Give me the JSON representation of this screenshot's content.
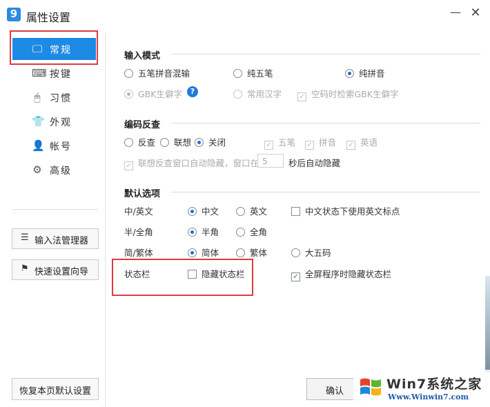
{
  "window": {
    "title": "属性设置",
    "app_icon": "9",
    "minimize": "—",
    "close": "✕"
  },
  "sidebar": {
    "items": [
      {
        "label": "常规",
        "icon": "monitor-icon",
        "glyph": "🖵",
        "active": true
      },
      {
        "label": "按键",
        "icon": "keyboard-icon",
        "glyph": "⌨"
      },
      {
        "label": "习惯",
        "icon": "mouse-icon",
        "glyph": "🖱"
      },
      {
        "label": "外观",
        "icon": "shirt-icon",
        "glyph": "👕"
      },
      {
        "label": "帐号",
        "icon": "user-icon",
        "glyph": "👤"
      },
      {
        "label": "高级",
        "icon": "gear-icon",
        "glyph": "⚙"
      }
    ],
    "buttons": [
      {
        "label": "输入法管理器",
        "icon": "list-icon",
        "glyph": "☰"
      },
      {
        "label": "快速设置向导",
        "icon": "flag-icon",
        "glyph": "⚑"
      }
    ],
    "restore_label": "恢复本页默认设置"
  },
  "input_mode": {
    "title": "输入模式",
    "options": [
      "五笔拼音混输",
      "纯五笔",
      "纯拼音"
    ],
    "selected": "纯拼音",
    "gbk_rare": "GBK生僻字",
    "common_chars": "常用汉字",
    "empty_code_search": "空码时检索GBK生僻字",
    "help": "?"
  },
  "reverse_lookup": {
    "title": "编码反查",
    "options": [
      "反查",
      "联想",
      "关闭"
    ],
    "selected": "关闭",
    "checks": [
      "五笔",
      "拼音",
      "英语"
    ],
    "auto_hide_prefix": "联想反查窗口自动隐藏，窗口在",
    "seconds": "5",
    "auto_hide_suffix": "秒后自动隐藏"
  },
  "defaults": {
    "title": "默认选项",
    "rows": [
      {
        "label": "中/英文",
        "opts": [
          "中文",
          "英文"
        ],
        "extra": "中文状态下使用英文标点"
      },
      {
        "label": "半/全角",
        "opts": [
          "半角",
          "全角"
        ]
      },
      {
        "label": "简/繁体",
        "opts": [
          "简体",
          "繁体",
          "大五码"
        ]
      }
    ],
    "status_bar_label": "状态栏",
    "hide_status_bar": "隐藏状态栏",
    "hide_in_fullscreen": "全屏程序时隐藏状态栏"
  },
  "footer": {
    "confirm": "确认"
  },
  "watermark": {
    "text": "Win7系统之家",
    "url": "Www.Winwin7.com"
  },
  "colors": {
    "accent": "#1d8ae5",
    "highlight_box": "#e0393e"
  }
}
